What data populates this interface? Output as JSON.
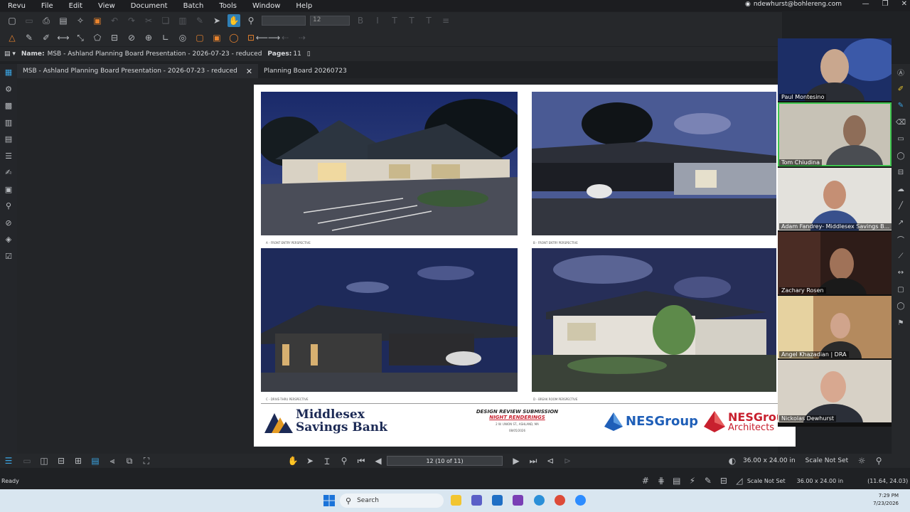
{
  "menubar": {
    "items": [
      "Revu",
      "File",
      "Edit",
      "View",
      "Document",
      "Batch",
      "Tools",
      "Window",
      "Help"
    ],
    "account": "ndewhurst@bohlereng.com"
  },
  "toolbar": {
    "font_size": "12"
  },
  "docinfo": {
    "name_label": "Name:",
    "name_value": "MSB - Ashland Planning Board Presentation - 2026-07-23 - reduced",
    "pages_label": "Pages:",
    "pages_value": "11"
  },
  "tabs": [
    {
      "label": "MSB - Ashland Planning Board Presentation - 2026-07-23 - reduced",
      "close": "✕"
    },
    {
      "label": "Planning Board 20260723"
    }
  ],
  "sheet": {
    "bank_name_line1": "Middlesex",
    "bank_name_line2": "Savings Bank",
    "design_title_line1": "DESIGN REVIEW SUBMISSION",
    "design_title_line2": "NIGHT RENDERINGS",
    "design_addr_line1": "2 W. UNION ST., ASHLAND, MA",
    "design_addr_line2": "08/05/2026",
    "nes_group": "NESGroup",
    "nes_architects_line1": "NESGroup",
    "nes_architects_line2": "Architects",
    "captions": [
      "A - FRONT ENTRY PERSPECTIVE",
      "B - FRONT ENTRY PERSPECTIVE",
      "C - DRIVE-THRU PERSPECTIVE",
      "D - BREAK ROOM PERSPECTIVE"
    ]
  },
  "bottombar": {
    "page_indicator": "12 (10 of 11)",
    "dimensions": "36.00 x 24.00 in",
    "scale": "Scale Not Set"
  },
  "statusbar": {
    "status": "Ready",
    "scale": "Scale Not Set",
    "dimensions": "36.00 x 24.00 in",
    "coords": "(11.64, 24.03)"
  },
  "taskbar": {
    "search_placeholder": "Search",
    "time": "7:29 PM",
    "date": "7/23/2026"
  },
  "participants": [
    {
      "name": "Paul Montesino",
      "speaking": false
    },
    {
      "name": "Tom Chiudina",
      "speaking": true
    },
    {
      "name": "Adam Fandrey- Middlesex Savings B...",
      "speaking": false
    },
    {
      "name": "Zachary Rosen",
      "speaking": false
    },
    {
      "name": "Angel Khazadian | DRA",
      "speaking": false
    },
    {
      "name": "Nickolas Dewhurst",
      "speaking": false
    }
  ],
  "colors": {
    "accent": "#2f7fb5",
    "speaking": "#3ec54e",
    "bank_navy": "#1c2a55",
    "bank_orange": "#e39a24",
    "nes_blue": "#1f5fb8",
    "nes_red": "#c8202e"
  }
}
